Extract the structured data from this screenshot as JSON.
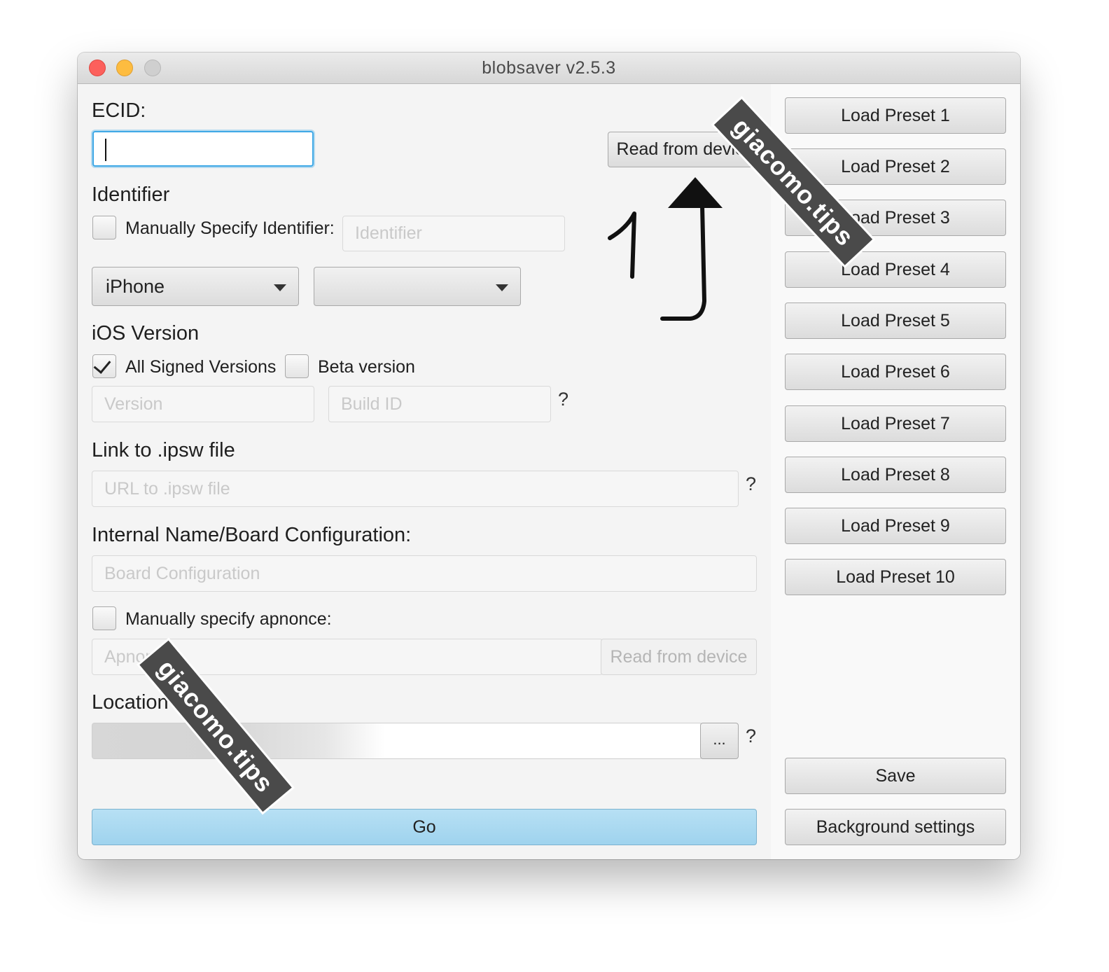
{
  "window": {
    "title": "blobsaver v2.5.3"
  },
  "ecid": {
    "label": "ECID:",
    "value": ""
  },
  "read_from_device_label": "Read from device",
  "identifier": {
    "section_label": "Identifier",
    "manual_checkbox_label": "Manually Specify Identifier:",
    "manual_checked": false,
    "placeholder": "Identifier"
  },
  "device": {
    "type_selected": "iPhone",
    "model_selected": ""
  },
  "ios_version": {
    "section_label": "iOS Version",
    "all_signed_label": "All Signed Versions",
    "all_signed_checked": true,
    "beta_label": "Beta version",
    "beta_checked": false,
    "version_placeholder": "Version",
    "build_id_placeholder": "Build ID",
    "help": "?"
  },
  "ipsw": {
    "section_label": "Link to .ipsw file",
    "placeholder": "URL to .ipsw file",
    "help": "?"
  },
  "board": {
    "section_label": "Internal Name/Board Configuration:",
    "placeholder": "Board Configuration"
  },
  "apnonce": {
    "checkbox_label": "Manually specify apnonce:",
    "checked": false,
    "placeholder": "Apnonce",
    "read_button_label": "Read from device"
  },
  "location": {
    "section_label": "Location",
    "browse_label": "...",
    "help": "?"
  },
  "go_label": "Go",
  "presets": [
    "Load Preset 1",
    "Load Preset 2",
    "Load Preset 3",
    "Load Preset 4",
    "Load Preset 5",
    "Load Preset 6",
    "Load Preset 7",
    "Load Preset 8",
    "Load Preset 9",
    "Load Preset 10"
  ],
  "save_label": "Save",
  "background_settings_label": "Background settings",
  "annotation": {
    "number": "1"
  },
  "watermark": "giacomo.tips"
}
